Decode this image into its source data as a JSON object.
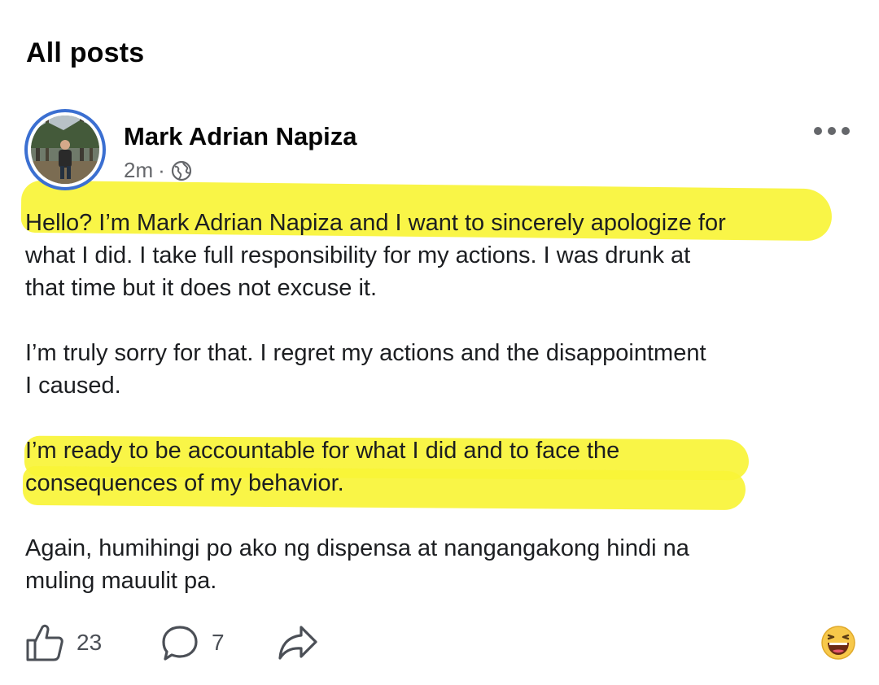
{
  "section": {
    "title": "All posts"
  },
  "post": {
    "author": "Mark Adrian Napiza",
    "time": "2m",
    "separator": "·",
    "privacy_icon": "globe-icon",
    "menu_icon": "more-horizontal-icon",
    "paragraphs": [
      "Hello? I’m Mark Adrian Napiza and I want to sincerely apologize for\nwhat I did. I take full responsibility for my actions. I was drunk at\nthat time but it does not excuse it.",
      "I’m truly sorry for that. I regret my actions and the disappointment\nI caused.",
      "I’m ready to be accountable for what I did and to face the\nconsequences of my behavior.",
      "Again, humihingi po ako ng dispensa at nangangakong hindi na\nmuling mauulit pa."
    ],
    "highlight_color": "#f8f437"
  },
  "actions": {
    "like_count": "23",
    "comment_count": "7",
    "like_icon": "thumbs-up-icon",
    "comment_icon": "comment-bubble-icon",
    "share_icon": "share-arrow-icon",
    "reaction_icon": "laughing-emoji-icon"
  },
  "colors": {
    "avatar_ring": "#3b6fd1",
    "meta_text": "#65676b",
    "icon": "#4b4f56"
  }
}
